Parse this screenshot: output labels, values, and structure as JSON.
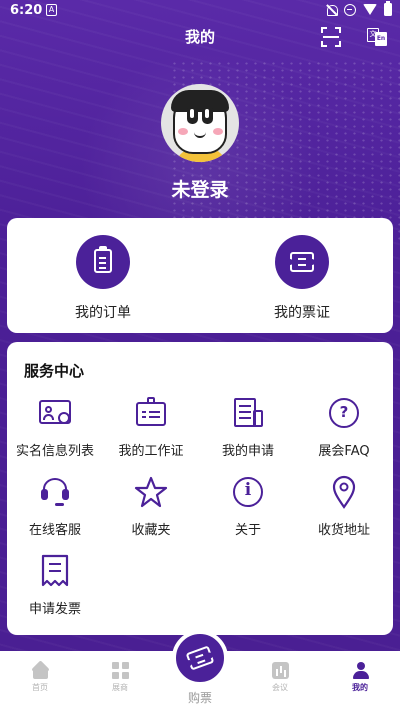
{
  "status_bar": {
    "time": "6:20",
    "app_badge": "A"
  },
  "nav": {
    "title": "我的",
    "translate_badge": "文",
    "translate_badge_alt": "En"
  },
  "profile": {
    "login_text": "未登录"
  },
  "quick_actions": [
    {
      "label": "我的订单",
      "icon": "clipboard-icon"
    },
    {
      "label": "我的票证",
      "icon": "ticket-icon"
    }
  ],
  "service": {
    "title": "服务中心",
    "items": [
      {
        "label": "实名信息列表",
        "icon": "id-card-icon"
      },
      {
        "label": "我的工作证",
        "icon": "badge-icon"
      },
      {
        "label": "我的申请",
        "icon": "document-icon"
      },
      {
        "label": "展会FAQ",
        "icon": "question-icon"
      },
      {
        "label": "在线客服",
        "icon": "headset-icon"
      },
      {
        "label": "收藏夹",
        "icon": "star-icon"
      },
      {
        "label": "关于",
        "icon": "info-icon"
      },
      {
        "label": "收货地址",
        "icon": "location-icon"
      },
      {
        "label": "申请发票",
        "icon": "invoice-icon"
      }
    ]
  },
  "tabbar": {
    "tabs": [
      {
        "label": "首页",
        "icon": "home-icon",
        "active": false
      },
      {
        "label": "展商",
        "icon": "grid-icon",
        "active": false
      },
      {
        "label": "购票",
        "icon": "ticket-icon",
        "active": false
      },
      {
        "label": "会议",
        "icon": "chart-icon",
        "active": false
      },
      {
        "label": "我的",
        "icon": "person-icon",
        "active": true
      }
    ]
  },
  "colors": {
    "primary": "#4b2199",
    "inactive": "#b3b3b3"
  }
}
